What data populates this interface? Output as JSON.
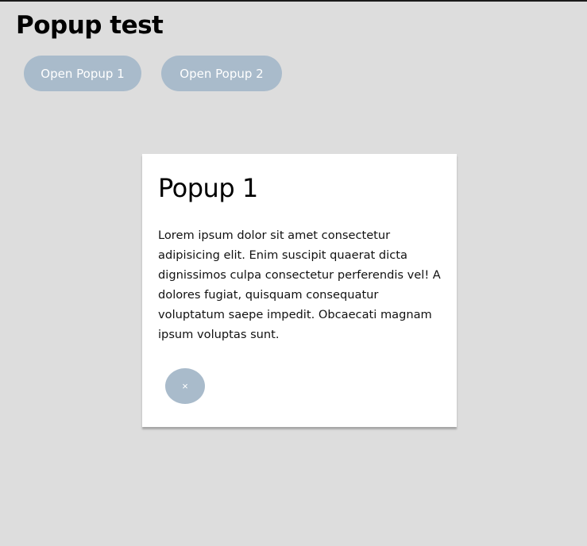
{
  "page": {
    "title": "Popup test"
  },
  "buttons": {
    "open1": "Open Popup 1",
    "open2": "Open Popup 2"
  },
  "popup": {
    "title": "Popup 1",
    "body": "Lorem ipsum dolor sit amet consectetur adipisicing elit. Enim suscipit quaerat dicta dignissimos culpa consectetur perferendis vel! A dolores fugiat, quisquam consequatur voluptatum saepe impedit. Obcaecati magnam ipsum voluptas sunt.",
    "close_label": "×"
  },
  "colors": {
    "button": "#a9bbcb",
    "background": "#dddddd"
  }
}
